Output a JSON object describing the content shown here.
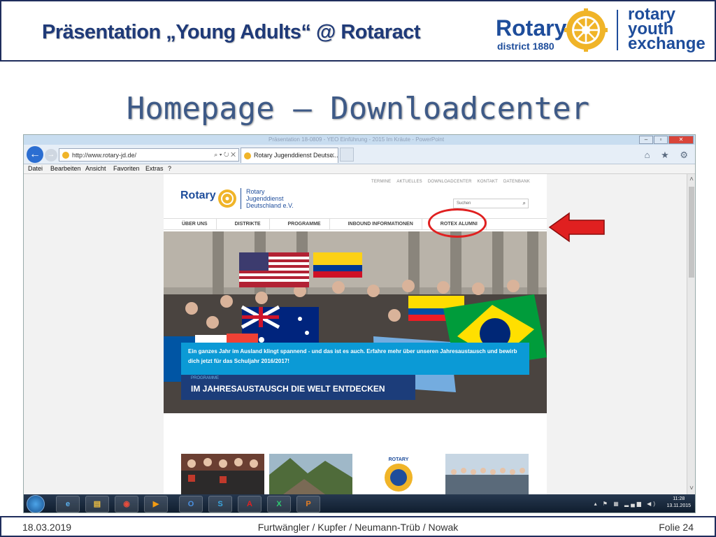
{
  "header": {
    "title": "Präsentation „Young Adults“ @ Rotaract",
    "logo_rotary": "Rotary",
    "logo_district": "district 1880",
    "logo_ye_line1": "rotary",
    "logo_ye_line2": "youth",
    "logo_ye_line3": "exchange"
  },
  "main_title": "Homepage – Downloadcenter",
  "browser": {
    "window_title": "Präsentation 18-0809 - YEO Einführung - 2015 Im Kräute - PowerPoint",
    "url": "http://www.rotary-jd.de/",
    "address_controls": "⌕ ▾ ↻ ✕",
    "tab_title": "Rotary Jugenddienst Deutsc...",
    "tab_close": "✕",
    "menu": [
      "Datei",
      "Bearbeiten",
      "Ansicht",
      "Favoriten",
      "Extras",
      "?"
    ],
    "tool_icons": "⌂ ★ ⚙"
  },
  "site": {
    "top_links": [
      "TERMINE",
      "AKTUELLES",
      "DOWNLOADCENTER",
      "KONTAKT",
      "DATENBANK"
    ],
    "logo": "Rotary",
    "org_line1": "Rotary",
    "org_line2": "Jugenddienst",
    "org_line3": "Deutschland e.V.",
    "search_placeholder": "Suchen",
    "nav": [
      "ÜBER UNS",
      "DISTRIKTE",
      "PROGRAMME",
      "INBOUND INFORMATIONEN",
      "ROTEX ALUMNI"
    ],
    "hero_kicker": "PROGRAMME",
    "hero_headline": "IM JAHRESAUSTAUSCH DIE WELT ENTDECKEN",
    "hero_teaser": "Ein ganzes Jahr im Ausland klingt spannend - und das ist es auch. Erfahre mehr über unseren Jahresaustausch und bewirb dich jetzt für das Schuljahr 2016/2017!",
    "thumb_label": "ROTARY"
  },
  "taskbar": {
    "time": "11:28",
    "date": "13.11.2015",
    "apps": [
      "e",
      "▤",
      "◉",
      "▶",
      "O",
      "S",
      "A",
      "X",
      "P"
    ]
  },
  "footer": {
    "date": "18.03.2019",
    "authors": "Furtwängler / Kupfer / Neumann-Trüb / Nowak",
    "slide": "Folie 24"
  },
  "colors": {
    "title_blue": "#1f3a78",
    "rotary_blue": "#1e4d9b",
    "rotary_gold": "#f0b428",
    "highlight_red": "#e02020",
    "teaser_blue": "#0b9ad6"
  }
}
